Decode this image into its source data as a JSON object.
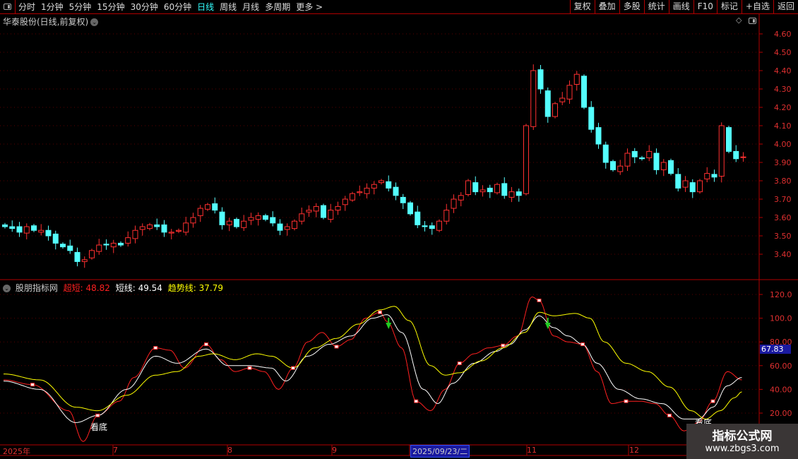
{
  "toolbar": {
    "periods": [
      "分时",
      "1分钟",
      "5分钟",
      "15分钟",
      "30分钟",
      "60分钟",
      "日线",
      "周线",
      "月线",
      "多周期",
      "更多 >"
    ],
    "active": "日线",
    "right_buttons": [
      "复权",
      "叠加",
      "多股",
      "统计",
      "画线",
      "F10",
      "标记",
      "+自选",
      "返回"
    ]
  },
  "main": {
    "title": "华泰股份(日线,前复权)",
    "price_ticks": [
      "4.60",
      "4.50",
      "4.40",
      "4.30",
      "4.20",
      "4.10",
      "4.00",
      "3.90",
      "3.80",
      "3.70",
      "3.60",
      "3.50",
      "3.40"
    ]
  },
  "indicator": {
    "name": "股朋指标网",
    "fast_label": "超短: 48.82",
    "short_label": "短线: 49.54",
    "trend_label": "趋势线: 37.79",
    "ticks": [
      "120.0",
      "100.0",
      "80.00",
      "60.00",
      "40.00",
      "20.00"
    ],
    "current_value": "67.83",
    "bottom_signal": "看底"
  },
  "dates": {
    "labels": [
      "2025年",
      "7",
      "8",
      "9",
      "11",
      "12"
    ],
    "selected": "2025/09/23/二"
  },
  "watermark": {
    "title": "指标公式网",
    "url": "www.zbgs3.com"
  },
  "colors": {
    "up": "#ff3030",
    "down": "#54ffff",
    "fast": "#ff2020",
    "short": "#ffffff",
    "trend": "#ffff00",
    "grid": "#b00000"
  },
  "chart_data": [
    {
      "type": "candlestick",
      "title": "华泰股份(日线,前复权)",
      "ylim": [
        3.3,
        4.65
      ],
      "closes": [
        3.55,
        3.54,
        3.52,
        3.55,
        3.53,
        3.53,
        3.5,
        3.46,
        3.44,
        3.42,
        3.36,
        3.37,
        3.42,
        3.45,
        3.45,
        3.46,
        3.45,
        3.49,
        3.53,
        3.55,
        3.56,
        3.55,
        3.52,
        3.52,
        3.53,
        3.57,
        3.6,
        3.65,
        3.67,
        3.64,
        3.56,
        3.58,
        3.55,
        3.58,
        3.6,
        3.61,
        3.59,
        3.57,
        3.53,
        3.55,
        3.58,
        3.62,
        3.64,
        3.66,
        3.6,
        3.64,
        3.66,
        3.7,
        3.73,
        3.74,
        3.76,
        3.78,
        3.8,
        3.76,
        3.72,
        3.68,
        3.62,
        3.56,
        3.55,
        3.54,
        3.58,
        3.64,
        3.7,
        3.72,
        3.8,
        3.74,
        3.75,
        3.74,
        3.78,
        3.72,
        3.74,
        3.72,
        4.1,
        4.4,
        4.3,
        4.15,
        4.22,
        4.25,
        4.32,
        4.38,
        4.2,
        4.08,
        4.0,
        3.9,
        3.86,
        3.88,
        3.95,
        3.93,
        3.92,
        3.96,
        3.86,
        3.9,
        3.84,
        3.76,
        3.8,
        3.74,
        3.8,
        3.84,
        3.82,
        4.1,
        3.96,
        3.92,
        3.93
      ]
    },
    {
      "type": "line",
      "ylim": [
        0,
        125
      ],
      "series": [
        {
          "name": "超短",
          "points": [
            [
              0,
              48
            ],
            [
              4,
              44
            ],
            [
              9,
              22
            ],
            [
              11,
              -4
            ],
            [
              13,
              18
            ],
            [
              16,
              30
            ],
            [
              18,
              50
            ],
            [
              21,
              75
            ],
            [
              23,
              73
            ],
            [
              25,
              58
            ],
            [
              28,
              78
            ],
            [
              30,
              65
            ],
            [
              32,
              55
            ],
            [
              34,
              58
            ],
            [
              36,
              55
            ],
            [
              38,
              40
            ],
            [
              40,
              58
            ],
            [
              42,
              80
            ],
            [
              44,
              88
            ],
            [
              46,
              76
            ],
            [
              48,
              82
            ],
            [
              50,
              100
            ],
            [
              52,
              105
            ],
            [
              53,
              97
            ],
            [
              55,
              75
            ],
            [
              57,
              30
            ],
            [
              59,
              22
            ],
            [
              61,
              40
            ],
            [
              63,
              62
            ],
            [
              65,
              70
            ],
            [
              67,
              75
            ],
            [
              69,
              77
            ],
            [
              71,
              85
            ],
            [
              73,
              118
            ],
            [
              74,
              115
            ],
            [
              76,
              85
            ],
            [
              78,
              80
            ],
            [
              80,
              78
            ],
            [
              82,
              55
            ],
            [
              84,
              28
            ],
            [
              86,
              30
            ],
            [
              88,
              30
            ],
            [
              90,
              28
            ],
            [
              92,
              18
            ],
            [
              94,
              5
            ],
            [
              96,
              12
            ],
            [
              98,
              30
            ],
            [
              100,
              55
            ],
            [
              102,
              48
            ]
          ]
        },
        {
          "name": "短线",
          "points": [
            [
              0,
              47
            ],
            [
              5,
              40
            ],
            [
              10,
              12
            ],
            [
              13,
              18
            ],
            [
              17,
              40
            ],
            [
              21,
              68
            ],
            [
              24,
              62
            ],
            [
              28,
              74
            ],
            [
              31,
              60
            ],
            [
              34,
              60
            ],
            [
              37,
              58
            ],
            [
              39,
              47
            ],
            [
              42,
              68
            ],
            [
              45,
              78
            ],
            [
              48,
              85
            ],
            [
              51,
              100
            ],
            [
              53,
              103
            ],
            [
              55,
              88
            ],
            [
              58,
              40
            ],
            [
              60,
              28
            ],
            [
              62,
              45
            ],
            [
              65,
              62
            ],
            [
              68,
              72
            ],
            [
              70,
              78
            ],
            [
              72,
              90
            ],
            [
              74,
              102
            ],
            [
              76,
              92
            ],
            [
              78,
              85
            ],
            [
              80,
              78
            ],
            [
              82,
              62
            ],
            [
              85,
              40
            ],
            [
              88,
              32
            ],
            [
              91,
              28
            ],
            [
              94,
              15
            ],
            [
              96,
              15
            ],
            [
              98,
              25
            ],
            [
              100,
              43
            ],
            [
              102,
              50
            ]
          ]
        },
        {
          "name": "趋势线",
          "points": [
            [
              0,
              53
            ],
            [
              5,
              48
            ],
            [
              10,
              25
            ],
            [
              13,
              22
            ],
            [
              17,
              35
            ],
            [
              21,
              52
            ],
            [
              24,
              55
            ],
            [
              27,
              68
            ],
            [
              29,
              70
            ],
            [
              32,
              65
            ],
            [
              35,
              70
            ],
            [
              37,
              68
            ],
            [
              40,
              58
            ],
            [
              43,
              75
            ],
            [
              46,
              83
            ],
            [
              49,
              95
            ],
            [
              52,
              107
            ],
            [
              54,
              110
            ],
            [
              56,
              98
            ],
            [
              59,
              60
            ],
            [
              61,
              52
            ],
            [
              63,
              54
            ],
            [
              66,
              64
            ],
            [
              69,
              75
            ],
            [
              72,
              88
            ],
            [
              74,
              105
            ],
            [
              76,
              102
            ],
            [
              79,
              104
            ],
            [
              81,
              100
            ],
            [
              83,
              80
            ],
            [
              86,
              62
            ],
            [
              89,
              55
            ],
            [
              92,
              42
            ],
            [
              95,
              22
            ],
            [
              97,
              15
            ],
            [
              99,
              22
            ],
            [
              101,
              33
            ],
            [
              102,
              38
            ]
          ]
        }
      ],
      "sell_arrows": [
        53,
        75
      ],
      "bottom_signals": [
        12,
        95
      ]
    }
  ]
}
